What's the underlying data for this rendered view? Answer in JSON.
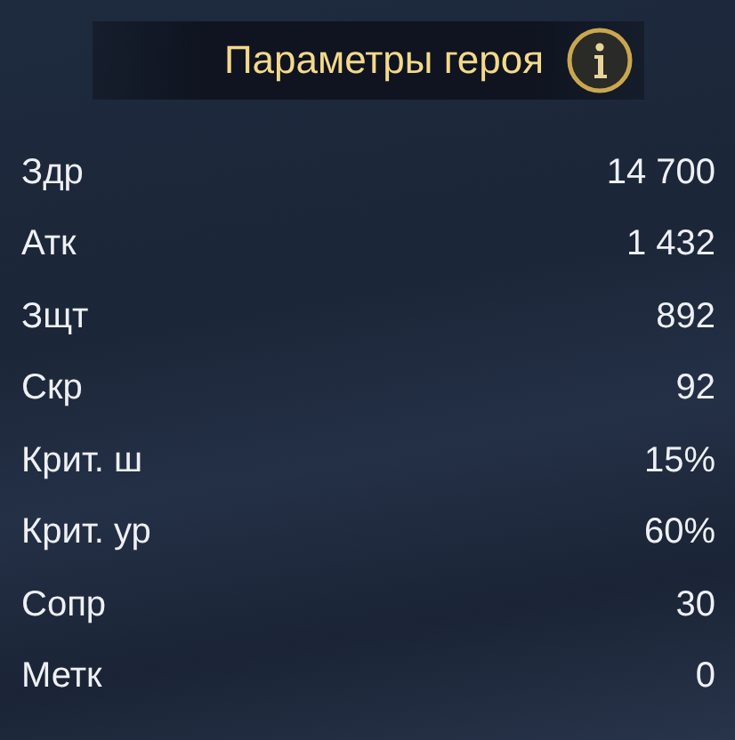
{
  "header": {
    "title": "Параметры героя"
  },
  "stats": [
    {
      "label": "Здр",
      "value": "14 700"
    },
    {
      "label": "Атк",
      "value": "1 432"
    },
    {
      "label": "Зщт",
      "value": "892"
    },
    {
      "label": "Скр",
      "value": "92"
    },
    {
      "label": "Крит. ш",
      "value": "15%"
    },
    {
      "label": "Крит. ур",
      "value": "60%"
    },
    {
      "label": "Сопр",
      "value": "30"
    },
    {
      "label": "Метк",
      "value": "0"
    }
  ]
}
